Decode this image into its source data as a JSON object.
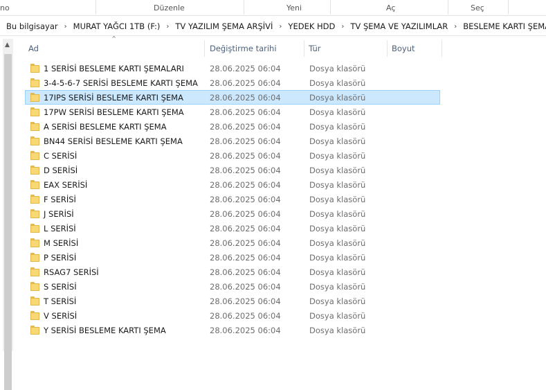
{
  "ribbon": {
    "groups": [
      "no",
      "Düzenle",
      "Yeni",
      "Aç",
      "Seç"
    ]
  },
  "address": {
    "crumbs": [
      "Bu bilgisayar",
      "MURAT YAĞCI 1TB (F:)",
      "TV YAZILIM ŞEMA ARŞİVİ",
      "YEDEK HDD",
      "TV ŞEMA VE YAZILIMLAR",
      "BESLEME KARTI ŞEMALARI"
    ],
    "separator": "›"
  },
  "columns": {
    "name": "Ad",
    "modified": "Değiştirme tarihi",
    "type": "Tür",
    "size": "Boyut"
  },
  "files": [
    {
      "name": "1 SERİSİ BESLEME KARTI ŞEMALARI",
      "modified": "28.06.2025 06:04",
      "type": "Dosya klasörü"
    },
    {
      "name": "3-4-5-6-7 SERİSİ BESLEME KARTI ŞEMA",
      "modified": "28.06.2025 06:04",
      "type": "Dosya klasörü"
    },
    {
      "name": "17IPS SERİSİ BESLEME KARTI ŞEMA",
      "modified": "28.06.2025 06:04",
      "type": "Dosya klasörü",
      "selected": true
    },
    {
      "name": "17PW SERİSİ BESLEME KARTI ŞEMA",
      "modified": "28.06.2025 06:04",
      "type": "Dosya klasörü"
    },
    {
      "name": "A SERİSİ BESLEME KARTI ŞEMA",
      "modified": "28.06.2025 06:04",
      "type": "Dosya klasörü"
    },
    {
      "name": "BN44 SERİSİ BESLEME KARTI ŞEMA",
      "modified": "28.06.2025 06:04",
      "type": "Dosya klasörü"
    },
    {
      "name": "C SERİSİ",
      "modified": "28.06.2025 06:04",
      "type": "Dosya klasörü"
    },
    {
      "name": "D SERİSİ",
      "modified": "28.06.2025 06:04",
      "type": "Dosya klasörü"
    },
    {
      "name": "EAX SERİSİ",
      "modified": "28.06.2025 06:04",
      "type": "Dosya klasörü"
    },
    {
      "name": "F SERİSİ",
      "modified": "28.06.2025 06:04",
      "type": "Dosya klasörü"
    },
    {
      "name": "J SERİSİ",
      "modified": "28.06.2025 06:04",
      "type": "Dosya klasörü"
    },
    {
      "name": "L SERİSİ",
      "modified": "28.06.2025 06:04",
      "type": "Dosya klasörü"
    },
    {
      "name": "M SERİSİ",
      "modified": "28.06.2025 06:04",
      "type": "Dosya klasörü"
    },
    {
      "name": "P SERİSİ",
      "modified": "28.06.2025 06:04",
      "type": "Dosya klasörü"
    },
    {
      "name": "RSAG7 SERİSİ",
      "modified": "28.06.2025 06:04",
      "type": "Dosya klasörü"
    },
    {
      "name": "S SERİSİ",
      "modified": "28.06.2025 06:04",
      "type": "Dosya klasörü"
    },
    {
      "name": "T SERİSİ",
      "modified": "28.06.2025 06:04",
      "type": "Dosya klasörü"
    },
    {
      "name": "V SERİSİ",
      "modified": "28.06.2025 06:04",
      "type": "Dosya klasörü"
    },
    {
      "name": "Y SERİSİ BESLEME KARTI ŞEMA",
      "modified": "28.06.2025 06:04",
      "type": "Dosya klasörü"
    }
  ],
  "icons": {
    "folder": "folder-icon",
    "sort": "sort-ascending-icon",
    "scroll_up": "scroll-up-arrow-icon"
  },
  "colors": {
    "selection_bg": "#cce8ff",
    "selection_border": "#99d1ff",
    "folder": "#f8d775",
    "header_text": "#4c607a"
  }
}
